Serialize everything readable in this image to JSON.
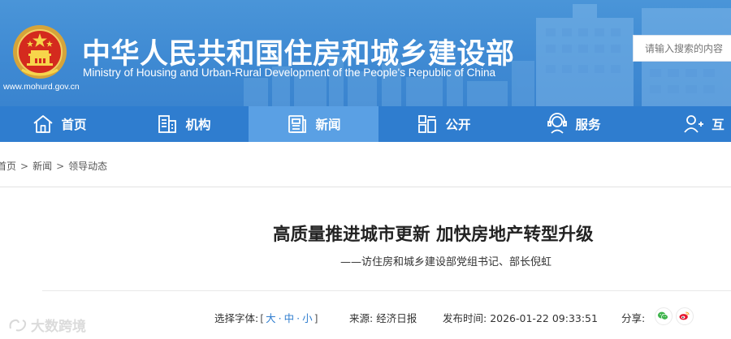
{
  "header": {
    "site_title": "中华人民共和国住房和城乡建设部",
    "site_subtitle": "Ministry of Housing and Urban-Rural Development of the People's Republic of China",
    "site_url": "www.mohurd.gov.cn",
    "search_placeholder": "请输入搜索的内容",
    "banner_color": "#3f8ad3"
  },
  "nav": {
    "bar_color": "#2f7dcf",
    "active_color": "#5aa0e4",
    "items": [
      {
        "label": "首页",
        "icon": "home-icon"
      },
      {
        "label": "机构",
        "icon": "building-icon"
      },
      {
        "label": "新闻",
        "icon": "news-icon",
        "active": true
      },
      {
        "label": "公开",
        "icon": "disclosure-icon"
      },
      {
        "label": "服务",
        "icon": "service-icon"
      },
      {
        "label": "互",
        "icon": "interaction-icon"
      }
    ]
  },
  "breadcrumb": {
    "items": [
      "首页",
      "新闻",
      "领导动态"
    ],
    "separator": ">"
  },
  "article": {
    "title": "高质量推进城市更新 加快房地产转型升级",
    "subtitle": "——访住房和城乡建设部党组书记、部长倪虹",
    "font_size_label": "选择字体:",
    "font_sizes": [
      "大",
      "中",
      "小"
    ],
    "source_label": "来源:",
    "source": "经济日报",
    "publish_time_label": "发布时间:",
    "publish_time": "2026-01-22 09:33:51",
    "share_label": "分享:",
    "share_icons": [
      "wechat-icon",
      "weibo-icon"
    ]
  },
  "watermark": {
    "text": "大数跨境"
  }
}
